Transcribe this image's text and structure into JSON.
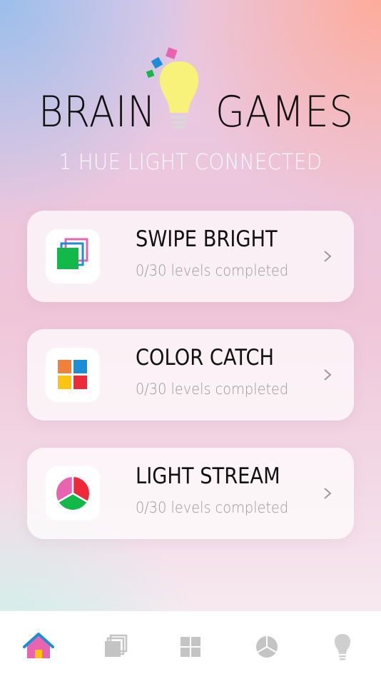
{
  "header": {
    "title_left": "BRAIN",
    "title_right": "GAMES",
    "subtitle": "1 HUE LIGHT CONNECTED"
  },
  "games": [
    {
      "title": "SWIPE BRIGHT",
      "progress": "0/30 levels completed",
      "icon": "stacked-cards-icon"
    },
    {
      "title": "COLOR CATCH",
      "progress": "0/30 levels completed",
      "icon": "color-grid-icon"
    },
    {
      "title": "LIGHT STREAM",
      "progress": "0/30 levels completed",
      "icon": "pie-segments-icon"
    }
  ],
  "tabbar": {
    "tabs": [
      {
        "icon": "home-icon",
        "active": true
      },
      {
        "icon": "stacked-cards-icon",
        "active": false
      },
      {
        "icon": "grid-icon",
        "active": false
      },
      {
        "icon": "pie-icon",
        "active": false
      },
      {
        "icon": "lightbulb-icon",
        "active": false
      }
    ]
  },
  "colors": {
    "green": "#12b84a",
    "blue": "#1a8fd8",
    "pink": "#e964b0",
    "red": "#ee2a3a",
    "orange": "#f0813a",
    "yellow": "#fdc40f",
    "bulb": "#f8f27a",
    "tab_inactive": "#c4c4c4"
  }
}
